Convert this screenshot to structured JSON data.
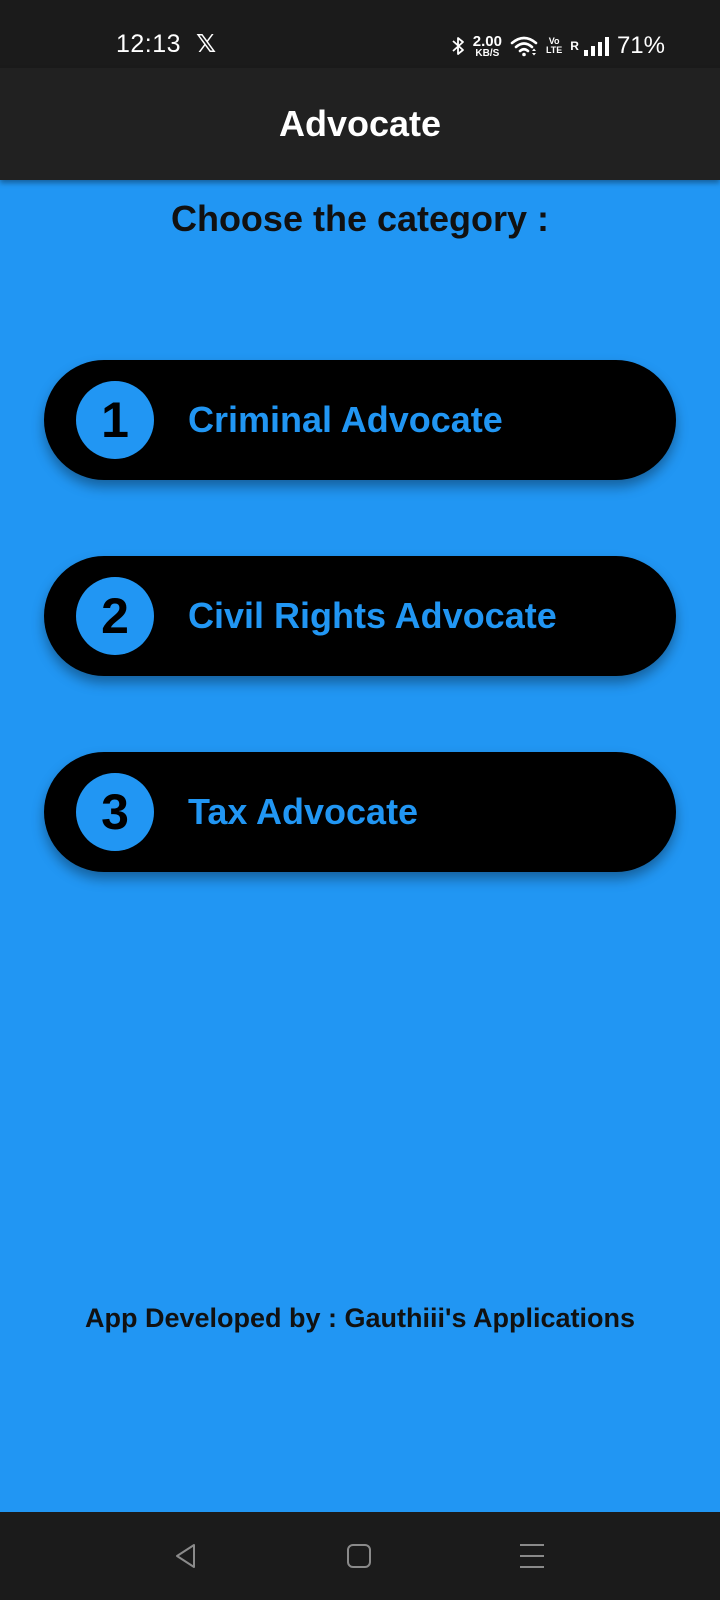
{
  "status_bar": {
    "time": "12:13",
    "x_glyph": "𝕏",
    "net_speed": "2.00",
    "net_unit": "KB/S",
    "volte_top": "Vo",
    "volte_bottom": "LTE",
    "roaming": "R",
    "battery": "71%"
  },
  "app_bar": {
    "title": "Advocate"
  },
  "heading": "Choose the category :",
  "categories": [
    {
      "number": "1",
      "label": "Criminal Advocate"
    },
    {
      "number": "2",
      "label": "Civil Rights Advocate"
    },
    {
      "number": "3",
      "label": "Tax Advocate"
    }
  ],
  "footer": {
    "credit": "App Developed by : Gauthiii's Applications"
  },
  "colors": {
    "background": "#2196f3",
    "app_bar": "#212121",
    "button": "#000000",
    "accent_text": "#2196f3"
  },
  "icons": {
    "status": [
      "bluetooth-icon",
      "wifi-icon",
      "signal-icon"
    ],
    "navigation": [
      "back-icon",
      "home-icon",
      "menu-icon"
    ]
  }
}
